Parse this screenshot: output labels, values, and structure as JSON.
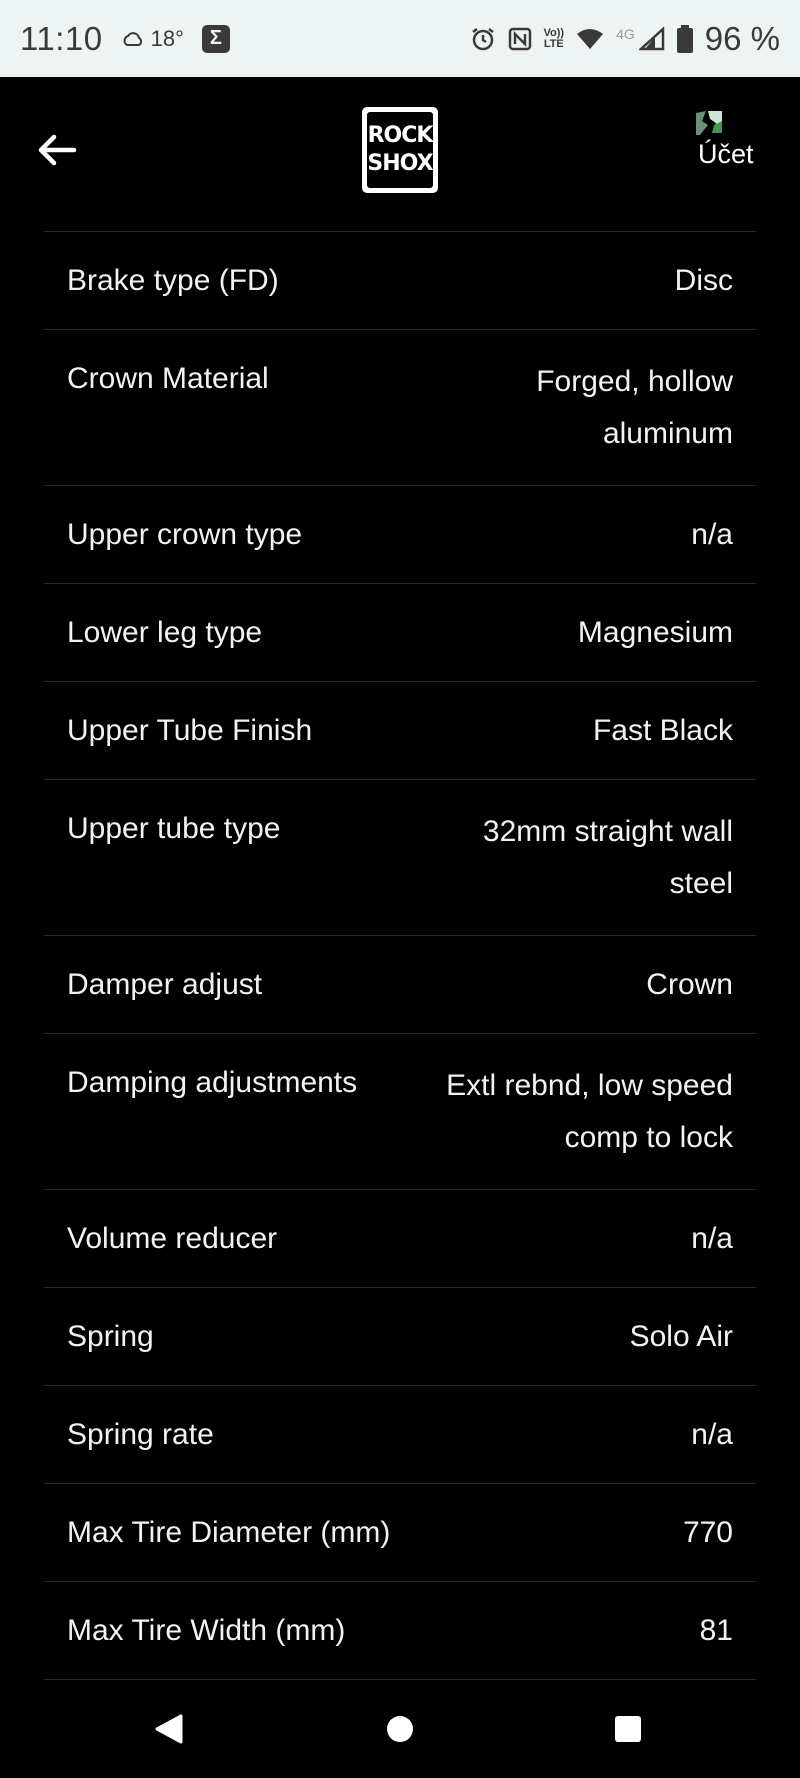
{
  "status_bar": {
    "time": "11:10",
    "temperature": "18°",
    "sigma_icon": "Σ",
    "signal_label_top": "Vo))",
    "signal_label_bottom": "LTE",
    "network_type": "4G",
    "battery": "96 %"
  },
  "header": {
    "logo_line1": "ROCK",
    "logo_line2": "SHOX",
    "account_label": "Účet"
  },
  "specs": [
    {
      "label": "Brake type (FD)",
      "value": "Disc"
    },
    {
      "label": "Crown Material",
      "value": "Forged, hollow aluminum"
    },
    {
      "label": "Upper crown type",
      "value": "n/a"
    },
    {
      "label": "Lower leg type",
      "value": "Magnesium"
    },
    {
      "label": "Upper Tube Finish",
      "value": "Fast Black"
    },
    {
      "label": "Upper tube type",
      "value": "32mm straight wall steel"
    },
    {
      "label": "Damper adjust",
      "value": "Crown"
    },
    {
      "label": "Damping adjustments",
      "value": "Extl rebnd, low speed comp to lock"
    },
    {
      "label": "Volume reducer",
      "value": "n/a"
    },
    {
      "label": "Spring",
      "value": "Solo Air"
    },
    {
      "label": "Spring rate",
      "value": "n/a"
    },
    {
      "label": "Max Tire Diameter (mm)",
      "value": "770"
    },
    {
      "label": "Max Tire Width (mm)",
      "value": "81"
    }
  ],
  "colors": {
    "background": "#000000",
    "status_bar": "#eef4f3",
    "text": "#f2f2f2",
    "divider": "#2a2a2a"
  }
}
